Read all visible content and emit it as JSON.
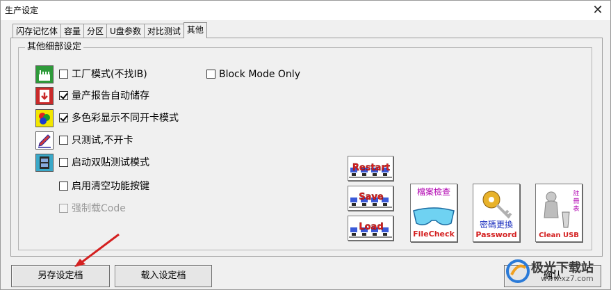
{
  "window": {
    "title": "生产设定",
    "close_glyph": "✕"
  },
  "tabs": [
    {
      "label": "闪存记忆体"
    },
    {
      "label": "容量"
    },
    {
      "label": "分区"
    },
    {
      "label": "U盘参数"
    },
    {
      "label": "对比测试"
    },
    {
      "label": "其他",
      "active": true
    }
  ],
  "group": {
    "title": "其他细部设定"
  },
  "options": [
    {
      "label": "工厂模式(不找IB)",
      "checked": false,
      "icon": "factory-icon"
    },
    {
      "label": "量产报告自动储存",
      "checked": true,
      "icon": "save-report-icon"
    },
    {
      "label": "多色彩显示不同开卡模式",
      "checked": true,
      "icon": "color-palette-icon"
    },
    {
      "label": "只测试,不开卡",
      "checked": false,
      "icon": "pencil-test-icon"
    },
    {
      "label": "启动双贴测试模式",
      "checked": false,
      "icon": "film-chip-icon"
    },
    {
      "label": "启用清空功能按键",
      "checked": false
    },
    {
      "label": "强制载Code",
      "checked": false,
      "disabled": true
    }
  ],
  "block_mode": {
    "label": "Block Mode Only",
    "checked": false
  },
  "image_buttons": {
    "restart": "Restart",
    "save": "Save",
    "load": "Load",
    "file_check": {
      "top": "檔案檢查",
      "bottom": "FileCheck"
    },
    "password": {
      "top": "密碼更換",
      "bottom": "Password"
    },
    "clean": {
      "side": "註冊表",
      "bottom": "Clean USB"
    }
  },
  "buttons": {
    "save_settings": "另存设定档",
    "load_settings": "载入设定档",
    "confirm": "确认"
  },
  "watermark": {
    "name": "极光下载站",
    "url": "www.xz7.com"
  },
  "colors": {
    "accent_red": "#d42020",
    "link_blue": "#1a2fbf",
    "magenta": "#b000b0"
  }
}
